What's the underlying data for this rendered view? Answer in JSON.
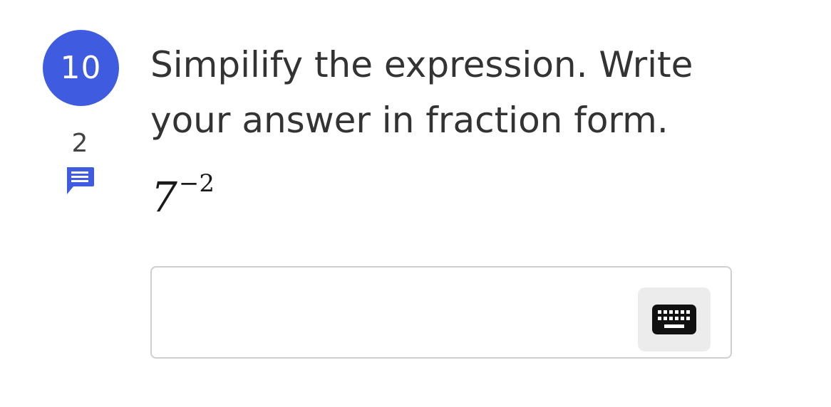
{
  "question": {
    "number": "10",
    "comment_count": "2",
    "prompt": "Simpilify the expression. Write your answer in fraction form.",
    "expression": {
      "base": "7",
      "exponent": "−2"
    }
  },
  "answer": {
    "value": "",
    "placeholder": ""
  },
  "icons": {
    "comment": "comment-icon",
    "keyboard": "keyboard-icon"
  },
  "colors": {
    "accent": "#3f5ce0",
    "text": "#333333",
    "border": "#cfcfcf",
    "keyboard_bg": "#ececec"
  }
}
